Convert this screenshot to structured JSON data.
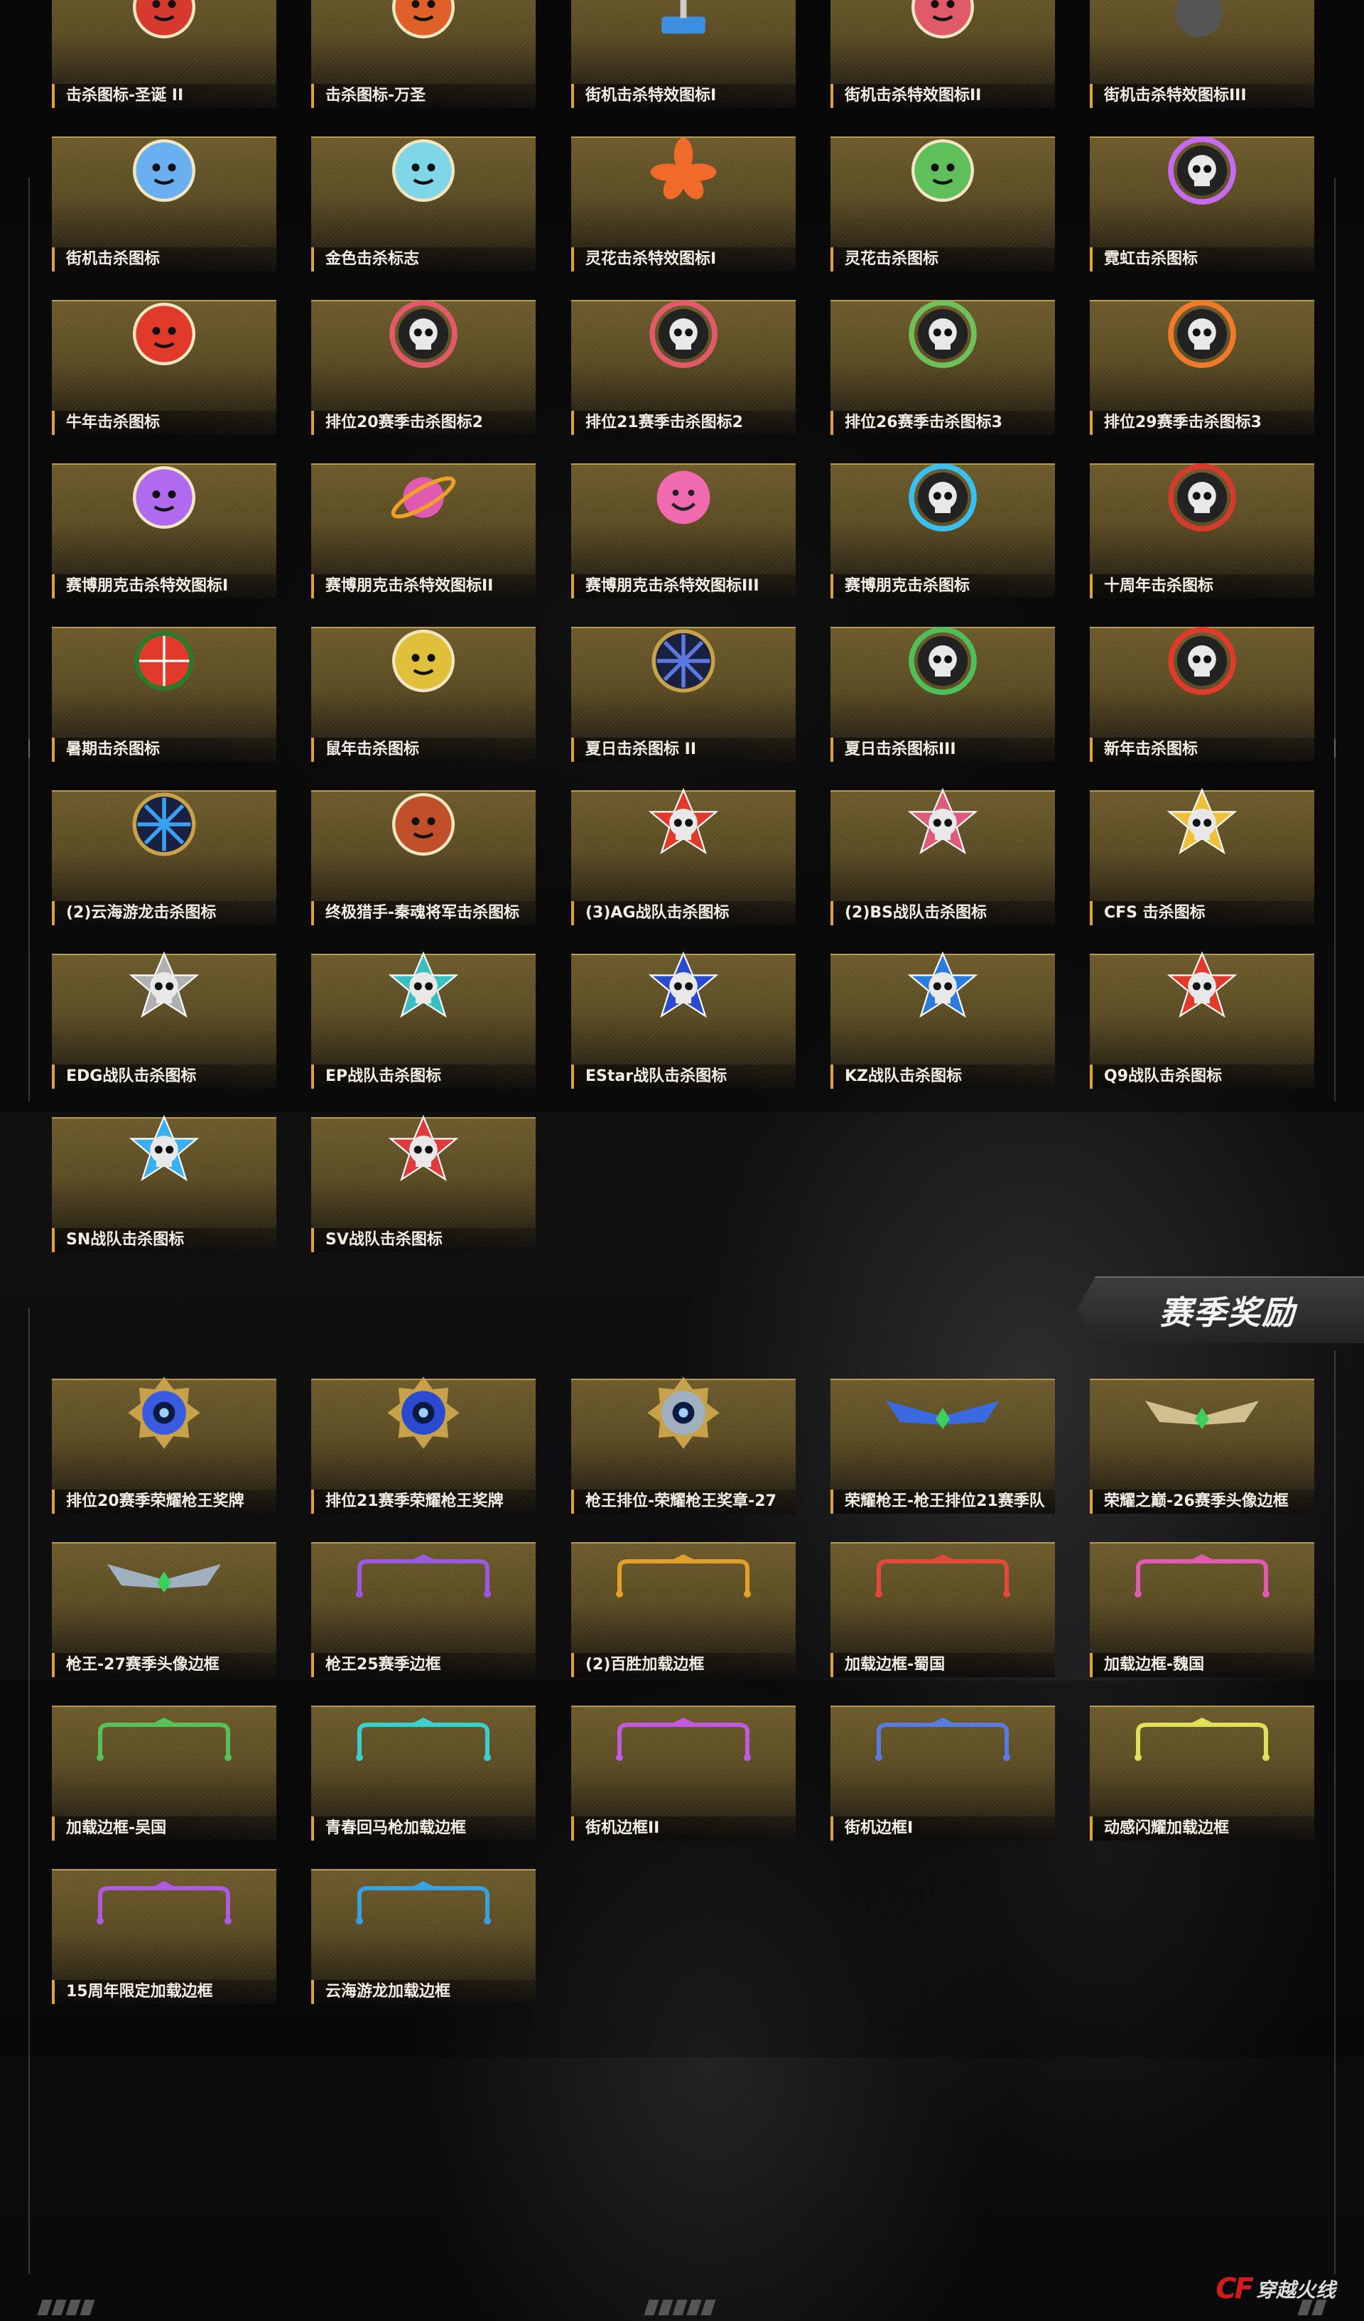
{
  "kill_icons": [
    {
      "label": "击杀图标-圣诞 II",
      "icon": "santa-icon",
      "color": "#d63a2f"
    },
    {
      "label": "击杀图标-万圣",
      "icon": "pumpkin-icon",
      "color": "#e0602a"
    },
    {
      "label": "街机击杀特效图标I",
      "icon": "joystick-icon",
      "color": "#3a8fe0"
    },
    {
      "label": "街机击杀特效图标II",
      "icon": "pixel-robot-icon",
      "color": "#e05a6a"
    },
    {
      "label": "街机击杀特效图标III",
      "icon": "bomb-icon",
      "color": "#9a9a9a"
    },
    {
      "label": "街机击杀图标",
      "icon": "headshot-icon",
      "color": "#6ab0f0"
    },
    {
      "label": "金色击杀标志",
      "icon": "gold-emblem-icon",
      "color": "#7fd6e6"
    },
    {
      "label": "灵花击杀特效图标I",
      "icon": "flower-icon",
      "color": "#f06a2a"
    },
    {
      "label": "灵花击杀图标",
      "icon": "flower-girl-icon",
      "color": "#5fbf5a"
    },
    {
      "label": "霓虹击杀图标",
      "icon": "neon-skull-icon",
      "color": "#c66af0"
    },
    {
      "label": "牛年击杀图标",
      "icon": "ox-icon",
      "color": "#e23a2a"
    },
    {
      "label": "排位20赛季击杀图标2",
      "icon": "skull-badge-icon",
      "color": "#e05a6a"
    },
    {
      "label": "排位21赛季击杀图标2",
      "icon": "skull-badge-icon",
      "color": "#e05a6a"
    },
    {
      "label": "排位26赛季击杀图标3",
      "icon": "skull-badge-icon",
      "color": "#6fbf5a"
    },
    {
      "label": "排位29赛季击杀图标3",
      "icon": "skull-badge-icon",
      "color": "#f07a2a"
    },
    {
      "label": "赛博朋克击杀特效图标I",
      "icon": "cyber-cat-icon",
      "color": "#b06af0"
    },
    {
      "label": "赛博朋克击杀特效图标II",
      "icon": "planet-icon",
      "color": "#f0a02a"
    },
    {
      "label": "赛博朋克击杀特效图标III",
      "icon": "smiley-icon",
      "color": "#f06ab0"
    },
    {
      "label": "赛博朋克击杀图标",
      "icon": "cyber-skull-icon",
      "color": "#3ac0f0"
    },
    {
      "label": "十周年击杀图标",
      "icon": "anniversary-skull-icon",
      "color": "#d63a2f"
    },
    {
      "label": "暑期击杀图标",
      "icon": "watermelon-icon",
      "color": "#e23a2a"
    },
    {
      "label": "鼠年击杀图标",
      "icon": "rat-icon",
      "color": "#e0c03a"
    },
    {
      "label": "夏日击杀图标 II",
      "icon": "wheel-icon",
      "color": "#5a7ae0"
    },
    {
      "label": "夏日击杀图标III",
      "icon": "flower-skull-icon",
      "color": "#4fbf5a"
    },
    {
      "label": "新年击杀图标",
      "icon": "newyear-skull-icon",
      "color": "#e23a2a"
    },
    {
      "label": "(2)云海游龙击杀图标",
      "icon": "snowflake-icon",
      "color": "#3aa0f0"
    },
    {
      "label": "终极猎手-秦魂将军击杀图标",
      "icon": "general-icon",
      "color": "#c0502a"
    },
    {
      "label": "(3)AG战队击杀图标",
      "icon": "team-skull-icon",
      "color": "#e23a2a"
    },
    {
      "label": "(2)BS战队击杀图标",
      "icon": "team-skull-icon",
      "color": "#e05a7a"
    },
    {
      "label": "CFS 击杀图标",
      "icon": "winged-skull-icon",
      "color": "#f0c03a"
    },
    {
      "label": "EDG战队击杀图标",
      "icon": "team-skull-icon",
      "color": "#b0b0b0"
    },
    {
      "label": "EP战队击杀图标",
      "icon": "team-skull-icon",
      "color": "#3ac0c0"
    },
    {
      "label": "EStar战队击杀图标",
      "icon": "team-skull-icon",
      "color": "#2a4ad0"
    },
    {
      "label": "KZ战队击杀图标",
      "icon": "team-skull-icon",
      "color": "#2a7ae0"
    },
    {
      "label": "Q9战队击杀图标",
      "icon": "team-skull-icon",
      "color": "#e23a2a"
    },
    {
      "label": "SN战队击杀图标",
      "icon": "team-skull-icon",
      "color": "#3ab0f0"
    },
    {
      "label": "SV战队击杀图标",
      "icon": "team-skull-icon",
      "color": "#e23a3a"
    }
  ],
  "section_title": "赛季奖励",
  "season_rewards": [
    {
      "label": "排位20赛季荣耀枪王奖牌",
      "icon": "medal-icon",
      "color": "#3a5ae0"
    },
    {
      "label": "排位21赛季荣耀枪王奖牌",
      "icon": "medal-icon",
      "color": "#2a4ad0"
    },
    {
      "label": "枪王排位-荣耀枪王奖章-27",
      "icon": "medal-icon",
      "color": "#a0b0c0"
    },
    {
      "label": "荣耀枪王-枪王排位21赛季队",
      "icon": "wing-frame-icon",
      "color": "#3a6ae0"
    },
    {
      "label": "荣耀之巅-26赛季头像边框",
      "icon": "wing-frame-icon",
      "color": "#d0c090"
    },
    {
      "label": "枪王-27赛季头像边框",
      "icon": "wing-frame-icon",
      "color": "#a0b0c0"
    },
    {
      "label": "枪王25赛季边框",
      "icon": "loading-frame-icon",
      "color": "#9a5ae0"
    },
    {
      "label": "(2)百胜加载边框",
      "icon": "loading-frame-icon",
      "color": "#e0a02a"
    },
    {
      "label": "加载边框-蜀国",
      "icon": "loading-frame-icon",
      "color": "#e04a3a"
    },
    {
      "label": "加载边框-魏国",
      "icon": "loading-frame-icon",
      "color": "#e05ab0"
    },
    {
      "label": "加载边框-吴国",
      "icon": "loading-frame-icon",
      "color": "#5ac05a"
    },
    {
      "label": "青春回马枪加载边框",
      "icon": "loading-frame-icon",
      "color": "#3ad0d0"
    },
    {
      "label": "街机边框II",
      "icon": "loading-frame-icon",
      "color": "#c05ae0"
    },
    {
      "label": "街机边框I",
      "icon": "loading-frame-icon",
      "color": "#5a7ae0"
    },
    {
      "label": "动感闪耀加载边框",
      "icon": "loading-frame-icon",
      "color": "#e0e05a"
    },
    {
      "label": "15周年限定加载边框",
      "icon": "loading-frame-icon",
      "color": "#b05ae0"
    },
    {
      "label": "云海游龙加载边框",
      "icon": "loading-frame-icon",
      "color": "#3aa0e0"
    }
  ],
  "logo": {
    "mark": "CF",
    "text": "穿越火线"
  }
}
